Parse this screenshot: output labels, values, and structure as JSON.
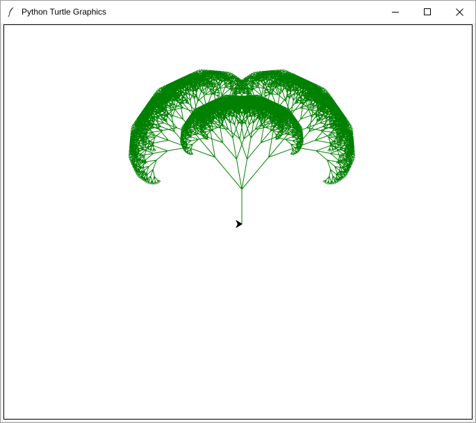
{
  "window": {
    "title": "Python Turtle Graphics",
    "icon": "feather-icon",
    "controls": [
      "minimize-icon",
      "maximize-icon",
      "close-icon"
    ]
  },
  "canvas": {
    "background": "#ffffff",
    "tree_color": "#008000",
    "turtle_color": "#000000",
    "turtle_shape": "arrow-turtle-icon",
    "turtle_heading_deg": 0
  }
}
